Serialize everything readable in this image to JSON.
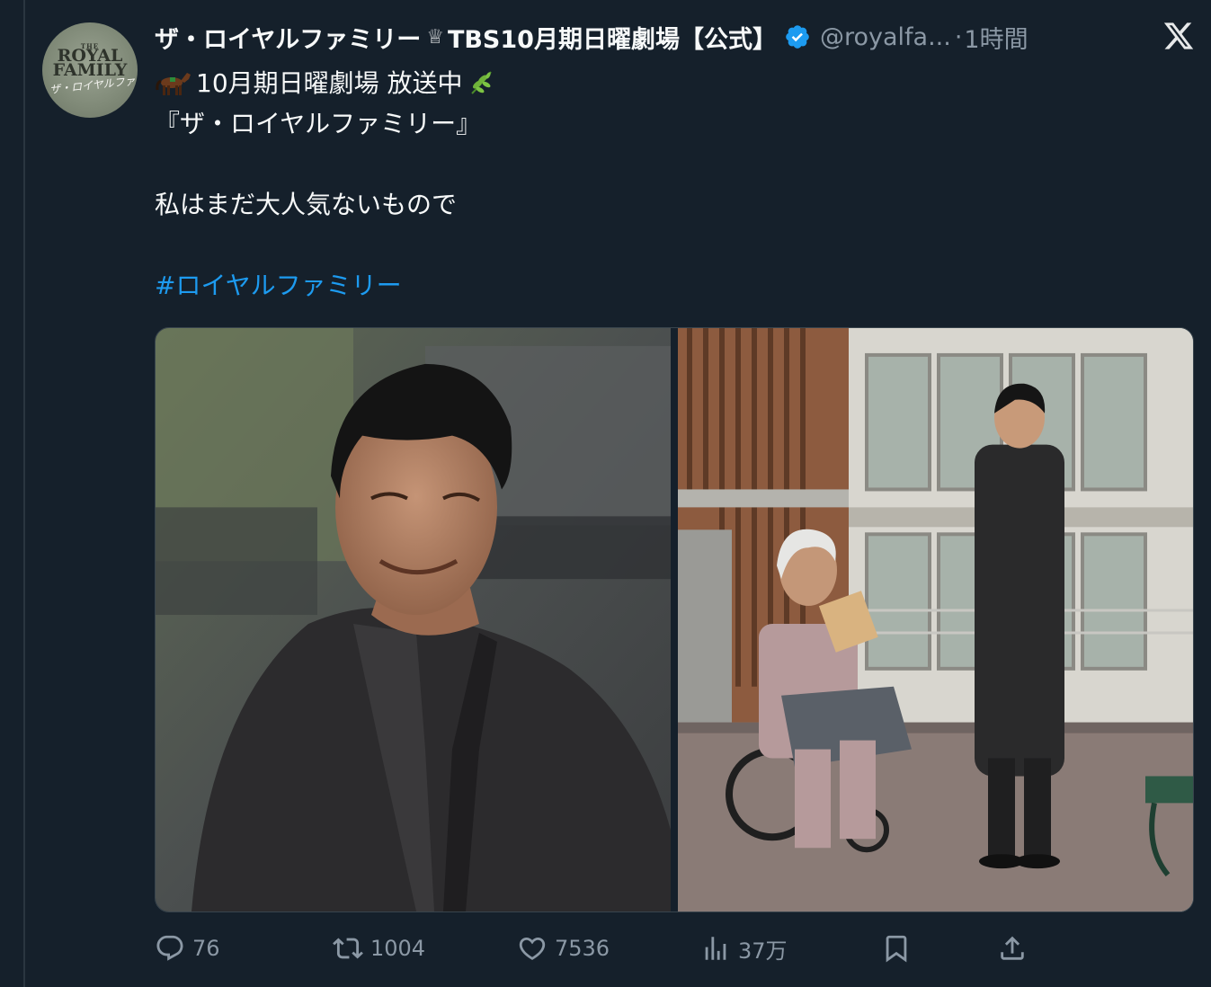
{
  "tweet": {
    "avatar": {
      "small_text": "THE",
      "brand_text": "ROYAL FAMILY",
      "script_text": "ザ・ロイヤルファミリー"
    },
    "author": {
      "display_name": "ザ・ロイヤルファミリー",
      "crown_icon": "♕",
      "display_name_suffix": "TBS10月期日曜劇場【公式】",
      "verified": true,
      "handle": "@royalfa...",
      "separator": "·",
      "timestamp": "1時間"
    },
    "text_lines": [
      "10月期日曜劇場 放送中",
      "『ザ・ロイヤルファミリー』",
      "",
      "私はまだ大人気ないもので",
      "",
      "#ロイヤルファミリー"
    ],
    "hashtag": "#ロイヤルファミリー",
    "media": [
      {
        "kind": "photo",
        "description": "portrait"
      },
      {
        "kind": "photo",
        "description": "scene"
      }
    ],
    "actions": {
      "reply_count": "76",
      "retweet_count": "1004",
      "like_count": "7536",
      "view_count": "37万"
    }
  },
  "colors": {
    "background": "#15202b",
    "text": "#f7f9f9",
    "secondary": "#8b98a5",
    "accent": "#1d9bf0",
    "border": "#38444d"
  },
  "icons": {
    "close": "x-logo-icon",
    "reply": "reply-icon",
    "retweet": "retweet-icon",
    "like": "heart-icon",
    "views": "views-icon",
    "bookmark": "bookmark-icon",
    "share": "share-icon",
    "verified": "verified-badge-icon"
  }
}
